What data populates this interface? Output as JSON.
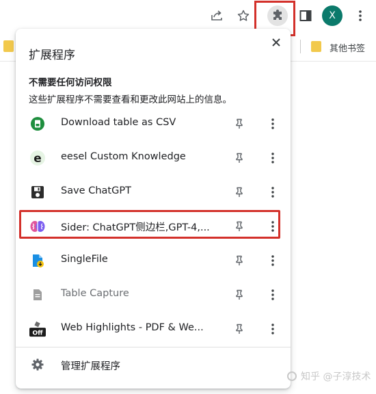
{
  "toolbar": {
    "share_icon": "share-icon",
    "bookmark_icon": "star-icon",
    "extensions_icon": "puzzle-icon",
    "side_panel_icon": "side-panel-icon",
    "profile_initial": "X",
    "profile_color": "#0b7a6b",
    "menu_icon": "kebab-icon"
  },
  "bookmarks_bar": {
    "other_bookmarks_label": "其他书签"
  },
  "extensions_popup": {
    "title": "扩展程序",
    "section_title": "不需要任何访问权限",
    "section_description": "这些扩展程序不需要查看和更改此网站上的信息。",
    "extensions": [
      {
        "name": "Download table as CSV",
        "icon": "csv-icon",
        "enabled": true
      },
      {
        "name": "eesel Custom Knowledge",
        "icon": "eesel-icon",
        "enabled": true
      },
      {
        "name": "Save ChatGPT",
        "icon": "floppy-disk-icon",
        "enabled": true
      },
      {
        "name": "Sider: ChatGPT侧边栏,GPT-4,...",
        "icon": "sider-brain-icon",
        "enabled": true,
        "highlighted": true
      },
      {
        "name": "SingleFile",
        "icon": "singlefile-icon",
        "enabled": true
      },
      {
        "name": "Table Capture",
        "icon": "table-capture-icon",
        "enabled": false
      },
      {
        "name": "Web Highlights - PDF & We...",
        "icon": "web-highlights-icon",
        "enabled": true,
        "icon_text": "Off"
      }
    ],
    "manage_label": "管理扩展程序"
  },
  "highlight_color": "#d3302a",
  "watermark": "知乎 @子淳技术"
}
